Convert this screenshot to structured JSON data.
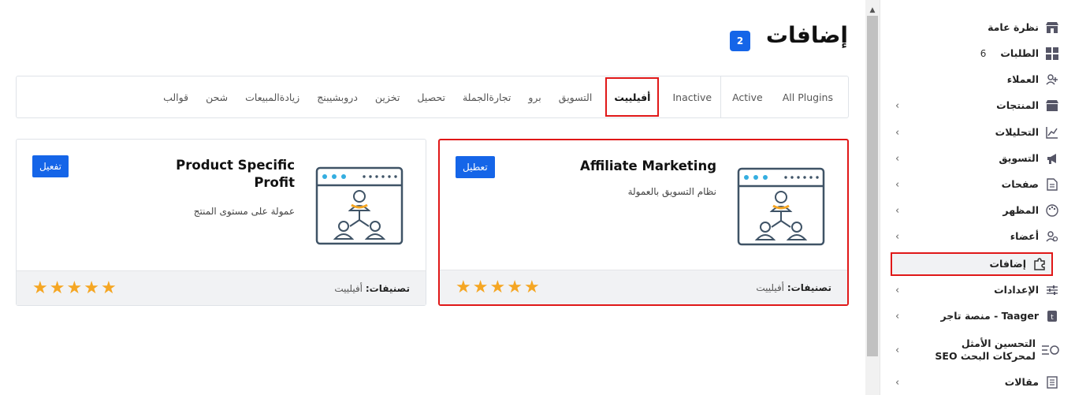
{
  "page": {
    "title": "إضافات",
    "count": "2"
  },
  "tabs": [
    {
      "label": "All Plugins"
    },
    {
      "label": "Active"
    },
    {
      "label": "Inactive"
    },
    {
      "label": "أفيلييت"
    },
    {
      "label": "التسويق"
    },
    {
      "label": "برو"
    },
    {
      "label": "تجارةالجملة"
    },
    {
      "label": "تحصيل"
    },
    {
      "label": "تخزين"
    },
    {
      "label": "دروبشيبنج"
    },
    {
      "label": "زيادةالمبيعات"
    },
    {
      "label": "شحن"
    },
    {
      "label": "قوالب"
    }
  ],
  "cards": [
    {
      "title": "Affiliate Marketing",
      "description": "نظام التسويق بالعمولة",
      "button": "تعطيل",
      "categories_label": "تصنيفات:",
      "categories_value": "أفيلييت",
      "rating": 5
    },
    {
      "title": "Product Specific Profit",
      "description": "عمولة على مستوى المنتج",
      "button": "تفعيل",
      "categories_label": "تصنيفات:",
      "categories_value": "أفيلييت",
      "rating": 5
    }
  ],
  "sidebar": {
    "items": [
      {
        "label": "نظرة عامة",
        "icon": "store-icon"
      },
      {
        "label": "الطلبات",
        "badge": "6",
        "icon": "grid-icon"
      },
      {
        "label": "العملاء",
        "icon": "users-icon"
      },
      {
        "label": "المنتجات",
        "icon": "shop-icon"
      },
      {
        "label": "التحليلات",
        "icon": "chart-icon"
      },
      {
        "label": "التسويق",
        "icon": "megaphone-icon"
      },
      {
        "label": "صفحات",
        "icon": "page-icon"
      },
      {
        "label": "المظهر",
        "icon": "palette-icon"
      },
      {
        "label": "أعضاء",
        "icon": "members-icon"
      },
      {
        "label": "إضافات",
        "icon": "puzzle-icon"
      },
      {
        "label": "الإعدادات",
        "icon": "sliders-icon"
      },
      {
        "label": "Taager - منصة تاجر",
        "icon": "taager-icon"
      },
      {
        "label": "التحسين الأمثل لمحركات البحث SEO",
        "icon": "seo-icon"
      },
      {
        "label": "مقالات",
        "icon": "article-icon"
      }
    ]
  },
  "colors": {
    "accent": "#1565e8",
    "highlight": "#e01818",
    "star": "#f5a623"
  }
}
